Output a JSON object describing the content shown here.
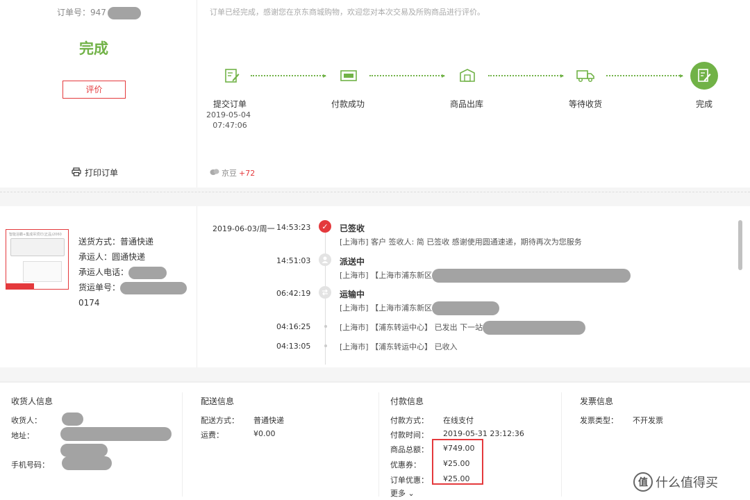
{
  "header": {
    "order_label": "订单号：947",
    "status": "完成",
    "review_button": "评价",
    "print_label": "打印订单",
    "thanks": "订单已经完成，感谢您在京东商城购物，欢迎您对本次交易及所购商品进行评价。",
    "jingdou_label": "京豆",
    "jingdou_value": "+72"
  },
  "steps": [
    {
      "label": "提交订单",
      "date": "2019-05-04",
      "time": "07:47:06"
    },
    {
      "label": "付款成功"
    },
    {
      "label": "商品出库"
    },
    {
      "label": "等待收货"
    },
    {
      "label": "完成"
    }
  ],
  "shipping": {
    "method_label": "送货方式：普通快递",
    "carrier_label": "承运人：圆通快递",
    "phone_label": "承运人电话：",
    "waybill_label": "货运单号：",
    "waybill_suffix": "0174",
    "product_title": "智能浴霸+集成吊顶灯(正品)2060"
  },
  "tracking": {
    "date": "2019-06-03/周一",
    "events": [
      {
        "time": "14:53:23",
        "status": "已签收",
        "desc": "[上海市] 客户 签收人: 简 已签收 感谢使用圆通速递，期待再次为您服务"
      },
      {
        "time": "14:51:03",
        "status": "派送中",
        "desc": "[上海市] 【上海市浦东新区"
      },
      {
        "time": "06:42:19",
        "status": "运输中",
        "desc": "[上海市] 【上海市浦东新区"
      },
      {
        "time": "04:16:25",
        "desc": "[上海市] 【浦东转运中心】 已发出 下一站"
      },
      {
        "time": "04:13:05",
        "desc": "[上海市] 【浦东转运中心】 已收入"
      }
    ]
  },
  "receiver": {
    "title": "收货人信息",
    "name_label": "收货人：",
    "address_label": "地址：",
    "phone_label": "手机号码："
  },
  "delivery": {
    "title": "配送信息",
    "method_label": "配送方式：",
    "method_value": "普通快递",
    "fee_label": "运费：",
    "fee_value": "¥0.00"
  },
  "payment": {
    "title": "付款信息",
    "method_label": "付款方式：",
    "method_value": "在线支付",
    "time_label": "付款时间：",
    "time_value": "2019-05-31 23:12:36",
    "total_label": "商品总额：",
    "total_value": "¥749.00",
    "coupon_label": "优惠券：",
    "coupon_value": "¥25.00",
    "discount_label": "订单优惠：",
    "discount_value": "¥25.00",
    "more": "更多"
  },
  "invoice": {
    "title": "发票信息",
    "type_label": "发票类型：",
    "type_value": "不开发票"
  },
  "watermark": {
    "text": "什么值得买",
    "logo": "值"
  },
  "colors": {
    "accent_green": "#71b247",
    "accent_red": "#e4393c"
  }
}
